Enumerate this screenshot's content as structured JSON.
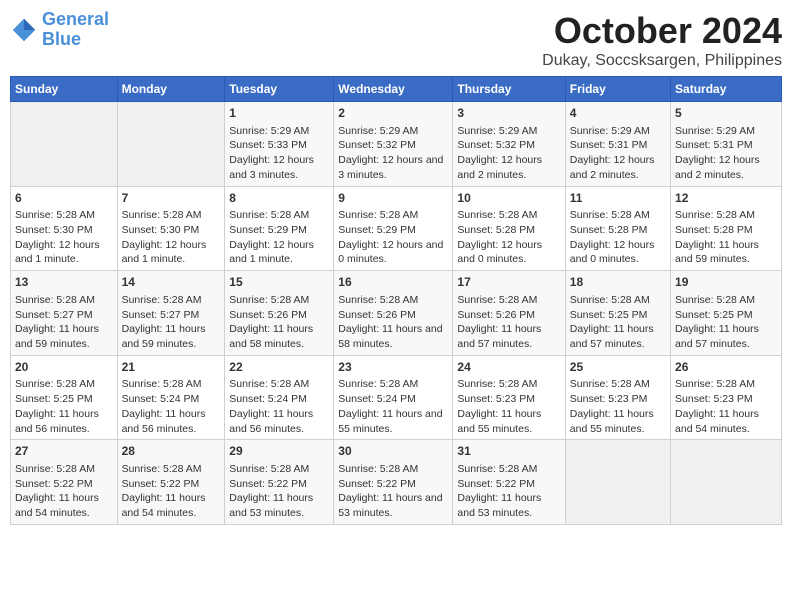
{
  "header": {
    "logo_line1": "General",
    "logo_line2": "Blue",
    "month": "October 2024",
    "location": "Dukay, Soccsksargen, Philippines"
  },
  "weekdays": [
    "Sunday",
    "Monday",
    "Tuesday",
    "Wednesday",
    "Thursday",
    "Friday",
    "Saturday"
  ],
  "weeks": [
    [
      {
        "day": "",
        "empty": true
      },
      {
        "day": "",
        "empty": true
      },
      {
        "day": "1",
        "sunrise": "5:29 AM",
        "sunset": "5:33 PM",
        "daylight": "12 hours and 3 minutes."
      },
      {
        "day": "2",
        "sunrise": "5:29 AM",
        "sunset": "5:32 PM",
        "daylight": "12 hours and 3 minutes."
      },
      {
        "day": "3",
        "sunrise": "5:29 AM",
        "sunset": "5:32 PM",
        "daylight": "12 hours and 2 minutes."
      },
      {
        "day": "4",
        "sunrise": "5:29 AM",
        "sunset": "5:31 PM",
        "daylight": "12 hours and 2 minutes."
      },
      {
        "day": "5",
        "sunrise": "5:29 AM",
        "sunset": "5:31 PM",
        "daylight": "12 hours and 2 minutes."
      }
    ],
    [
      {
        "day": "6",
        "sunrise": "5:28 AM",
        "sunset": "5:30 PM",
        "daylight": "12 hours and 1 minute."
      },
      {
        "day": "7",
        "sunrise": "5:28 AM",
        "sunset": "5:30 PM",
        "daylight": "12 hours and 1 minute."
      },
      {
        "day": "8",
        "sunrise": "5:28 AM",
        "sunset": "5:29 PM",
        "daylight": "12 hours and 1 minute."
      },
      {
        "day": "9",
        "sunrise": "5:28 AM",
        "sunset": "5:29 PM",
        "daylight": "12 hours and 0 minutes."
      },
      {
        "day": "10",
        "sunrise": "5:28 AM",
        "sunset": "5:28 PM",
        "daylight": "12 hours and 0 minutes."
      },
      {
        "day": "11",
        "sunrise": "5:28 AM",
        "sunset": "5:28 PM",
        "daylight": "12 hours and 0 minutes."
      },
      {
        "day": "12",
        "sunrise": "5:28 AM",
        "sunset": "5:28 PM",
        "daylight": "11 hours and 59 minutes."
      }
    ],
    [
      {
        "day": "13",
        "sunrise": "5:28 AM",
        "sunset": "5:27 PM",
        "daylight": "11 hours and 59 minutes."
      },
      {
        "day": "14",
        "sunrise": "5:28 AM",
        "sunset": "5:27 PM",
        "daylight": "11 hours and 59 minutes."
      },
      {
        "day": "15",
        "sunrise": "5:28 AM",
        "sunset": "5:26 PM",
        "daylight": "11 hours and 58 minutes."
      },
      {
        "day": "16",
        "sunrise": "5:28 AM",
        "sunset": "5:26 PM",
        "daylight": "11 hours and 58 minutes."
      },
      {
        "day": "17",
        "sunrise": "5:28 AM",
        "sunset": "5:26 PM",
        "daylight": "11 hours and 57 minutes."
      },
      {
        "day": "18",
        "sunrise": "5:28 AM",
        "sunset": "5:25 PM",
        "daylight": "11 hours and 57 minutes."
      },
      {
        "day": "19",
        "sunrise": "5:28 AM",
        "sunset": "5:25 PM",
        "daylight": "11 hours and 57 minutes."
      }
    ],
    [
      {
        "day": "20",
        "sunrise": "5:28 AM",
        "sunset": "5:25 PM",
        "daylight": "11 hours and 56 minutes."
      },
      {
        "day": "21",
        "sunrise": "5:28 AM",
        "sunset": "5:24 PM",
        "daylight": "11 hours and 56 minutes."
      },
      {
        "day": "22",
        "sunrise": "5:28 AM",
        "sunset": "5:24 PM",
        "daylight": "11 hours and 56 minutes."
      },
      {
        "day": "23",
        "sunrise": "5:28 AM",
        "sunset": "5:24 PM",
        "daylight": "11 hours and 55 minutes."
      },
      {
        "day": "24",
        "sunrise": "5:28 AM",
        "sunset": "5:23 PM",
        "daylight": "11 hours and 55 minutes."
      },
      {
        "day": "25",
        "sunrise": "5:28 AM",
        "sunset": "5:23 PM",
        "daylight": "11 hours and 55 minutes."
      },
      {
        "day": "26",
        "sunrise": "5:28 AM",
        "sunset": "5:23 PM",
        "daylight": "11 hours and 54 minutes."
      }
    ],
    [
      {
        "day": "27",
        "sunrise": "5:28 AM",
        "sunset": "5:22 PM",
        "daylight": "11 hours and 54 minutes."
      },
      {
        "day": "28",
        "sunrise": "5:28 AM",
        "sunset": "5:22 PM",
        "daylight": "11 hours and 54 minutes."
      },
      {
        "day": "29",
        "sunrise": "5:28 AM",
        "sunset": "5:22 PM",
        "daylight": "11 hours and 53 minutes."
      },
      {
        "day": "30",
        "sunrise": "5:28 AM",
        "sunset": "5:22 PM",
        "daylight": "11 hours and 53 minutes."
      },
      {
        "day": "31",
        "sunrise": "5:28 AM",
        "sunset": "5:22 PM",
        "daylight": "11 hours and 53 minutes."
      },
      {
        "day": "",
        "empty": true
      },
      {
        "day": "",
        "empty": true
      }
    ]
  ]
}
